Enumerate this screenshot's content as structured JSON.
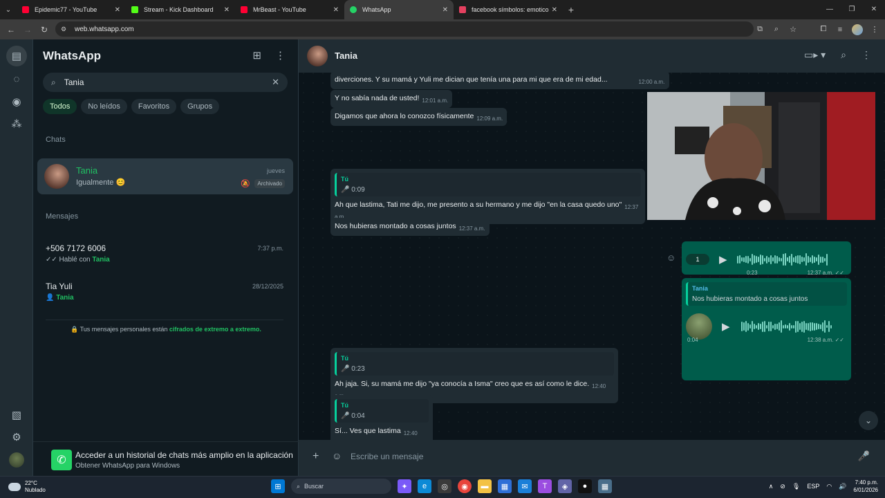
{
  "browser": {
    "tabs": [
      {
        "title": "Epidemic77 - YouTube",
        "color": "#ff0033",
        "active": false
      },
      {
        "title": "Stream - Kick Dashboard",
        "color": "#53fc18",
        "active": false
      },
      {
        "title": "MrBeast - YouTube",
        "color": "#ff0033",
        "active": false
      },
      {
        "title": "WhatsApp",
        "color": "#25d366",
        "active": true
      },
      {
        "title": "facebook símbolos: emoticones",
        "color": "#e4405f",
        "active": false
      }
    ],
    "url": "web.whatsapp.com"
  },
  "sidebar": {
    "title": "WhatsApp",
    "search_value": "Tania",
    "filters": [
      "Todos",
      "No leídos",
      "Favoritos",
      "Grupos"
    ],
    "chats_label": "Chats",
    "chat": {
      "name": "Tania",
      "time": "jueves",
      "message": "Igualmente 😊",
      "badge": "Archivado"
    },
    "messages_label": "Mensajes",
    "messages": [
      {
        "title": "+506 7172 6006",
        "time": "7:37 p.m.",
        "prefix": "✓✓ Hablé con ",
        "highlight": "Tania"
      },
      {
        "title": "Tia Yuli",
        "time": "28/12/2025",
        "prefix": "👤 ",
        "highlight": "Tania"
      }
    ],
    "e2e_text": "🔒 Tus mensajes personales están ",
    "e2e_link": "cifrados de extremo a extremo.",
    "promo_title": "Acceder a un historial de chats más amplio en la aplicación",
    "promo_sub": "Obtener WhatsApp para Windows"
  },
  "conversation": {
    "name": "Tania",
    "messages": [
      {
        "text": "diverciones. Y su mamá y Yuli me dician que tenía una para mi que era de mi edad...",
        "time": "12:00 a.m."
      },
      {
        "text": "Y no sabía nada de usted!",
        "time": "12:01 a.m."
      },
      {
        "text": "Digamos que ahora lo conozco físicamente",
        "time": "12:09 a.m."
      },
      {
        "quote_name": "Tú",
        "quote_dur": "🎤 0:09",
        "text": "Ah que lastima, Tati me dijo,  me presento a su hermano y me dijo \"en la casa quedo uno\"",
        "time": "12:37 a.m."
      },
      {
        "text": "Nos hubieras montado a cosas juntos",
        "time": "12:37 a.m."
      },
      {
        "quote_name": "Tú",
        "quote_dur": "🎤 0:23",
        "text": "Ah jaja. Si, su mamá me dijo \"ya conocía a Isma\" creo que es así como le dice.",
        "time": "12:40 a.m."
      },
      {
        "quote_name": "Tú",
        "quote_dur": "🎤 0:04",
        "text": "Sí... Ves que lastima",
        "time": "12:40 a.m."
      }
    ],
    "voice1": {
      "speed": "1",
      "duration": "0:23",
      "time": "12:37 a.m. ✓✓"
    },
    "voice2": {
      "quote_name": "Tania",
      "quote_text": "Nos hubieras montado a cosas juntos",
      "duration": "0:04",
      "time": "12:38 a.m. ✓✓"
    },
    "input_placeholder": "Escribe un mensaje"
  },
  "taskbar": {
    "temp": "22°C",
    "weather": "Nublado",
    "search": "Buscar",
    "lang": "ESP",
    "time": "7:40 p.m.",
    "date": "6/01/2026"
  }
}
